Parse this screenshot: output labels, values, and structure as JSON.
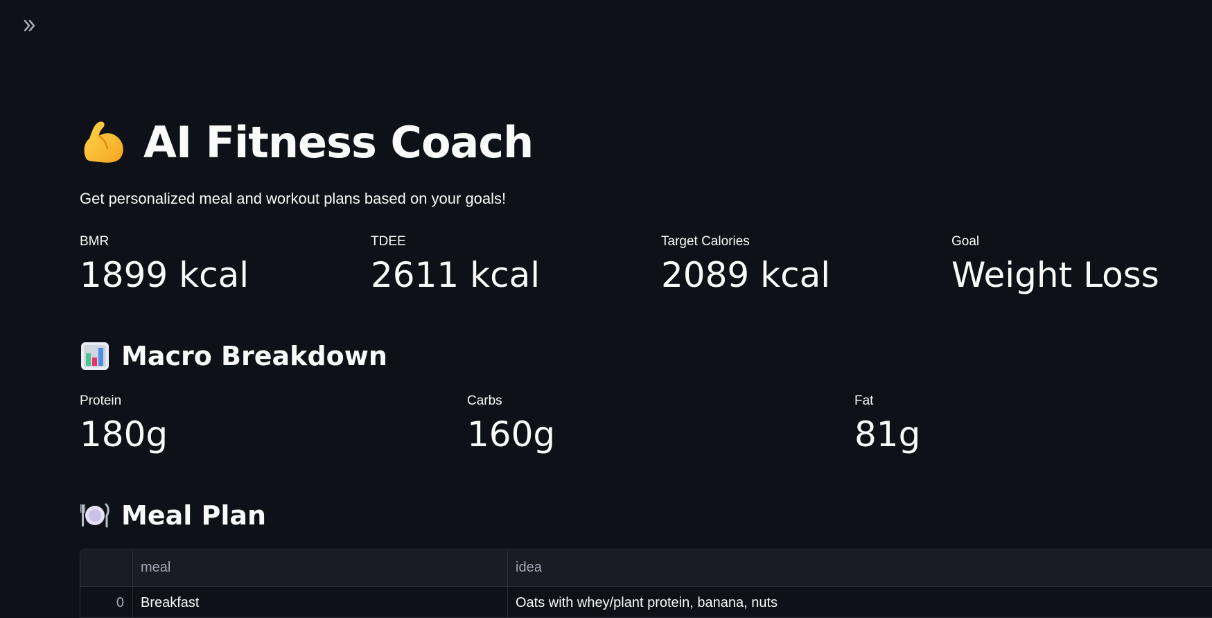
{
  "sidebar_toggle": {
    "icon": "double-chevron-right-icon"
  },
  "header": {
    "title": "AI Fitness Coach",
    "title_icon": "flexed-biceps-icon",
    "subtitle": "Get personalized meal and workout plans based on your goals!"
  },
  "metrics": [
    {
      "label": "BMR",
      "value": "1899 kcal"
    },
    {
      "label": "TDEE",
      "value": "2611 kcal"
    },
    {
      "label": "Target Calories",
      "value": "2089 kcal"
    },
    {
      "label": "Goal",
      "value": "Weight Loss"
    }
  ],
  "macro": {
    "title": "Macro Breakdown",
    "icon": "bar-chart-icon",
    "items": [
      {
        "label": "Protein",
        "value": "180g"
      },
      {
        "label": "Carbs",
        "value": "160g"
      },
      {
        "label": "Fat",
        "value": "81g"
      }
    ]
  },
  "meal_plan": {
    "title": "Meal Plan",
    "icon": "plate-with-cutlery-icon",
    "columns": [
      "",
      "meal",
      "idea"
    ],
    "rows": [
      {
        "index": "0",
        "meal": "Breakfast",
        "idea": "Oats with whey/plant protein, banana, nuts"
      }
    ]
  }
}
